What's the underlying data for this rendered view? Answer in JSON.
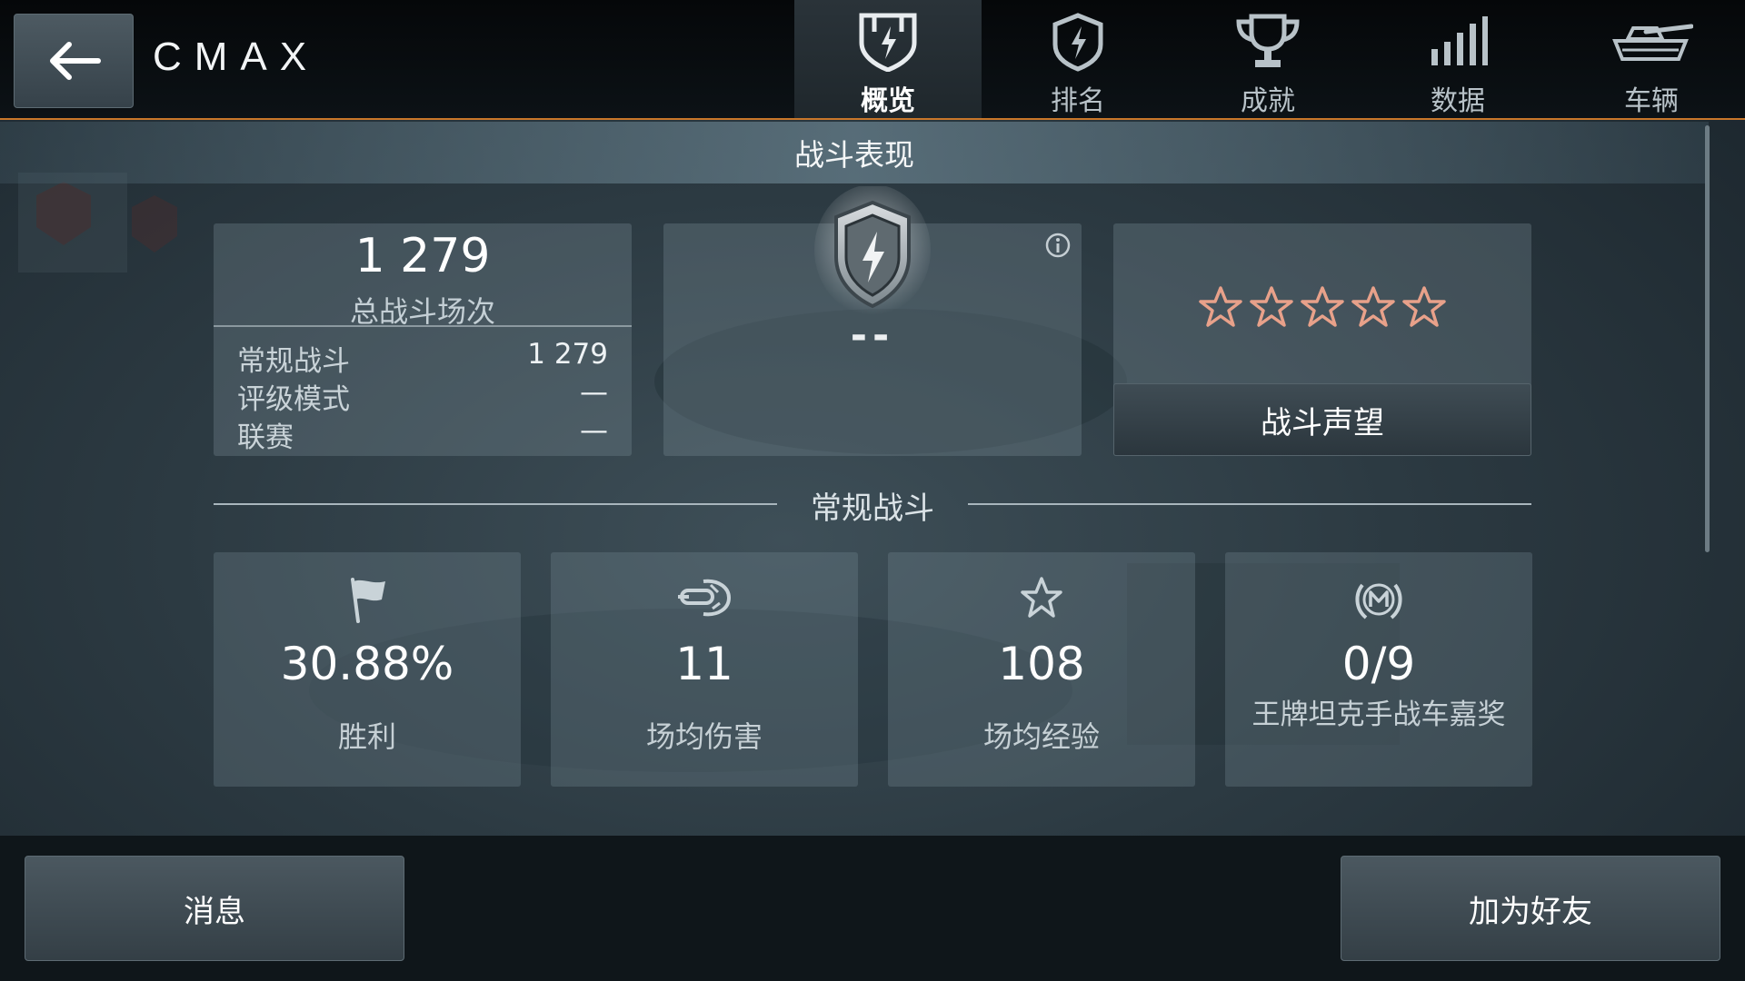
{
  "player": {
    "name": "CMAX"
  },
  "tabs": [
    {
      "label": "概览",
      "icon": "shield-tab-icon",
      "active": true
    },
    {
      "label": "排名",
      "icon": "ranking-icon",
      "active": false
    },
    {
      "label": "成就",
      "icon": "trophy-icon",
      "active": false
    },
    {
      "label": "数据",
      "icon": "bar-signal-icon",
      "active": false
    },
    {
      "label": "车辆",
      "icon": "tank-icon",
      "active": false
    }
  ],
  "section": {
    "title": "战斗表现"
  },
  "battles": {
    "total": "1 279",
    "total_label": "总战斗场次",
    "rows": [
      {
        "label": "常规战斗",
        "value": "1 279"
      },
      {
        "label": "评级模式",
        "value": "—"
      },
      {
        "label": "联赛",
        "value": "—"
      }
    ]
  },
  "rating": {
    "value": "--",
    "icon": "rating-shield-icon"
  },
  "reputation": {
    "stars": 5,
    "filled": 0,
    "button_label": "战斗声望",
    "star_color": "#e8a18a"
  },
  "regular": {
    "title": "常规战斗",
    "stats": [
      {
        "icon": "flag-icon",
        "value": "30.88%",
        "label": "胜利"
      },
      {
        "icon": "shell-damage-icon",
        "value": "11",
        "label": "场均伤害"
      },
      {
        "icon": "star-icon",
        "value": "108",
        "label": "场均经验"
      },
      {
        "icon": "mastery-badge-icon",
        "value": "0/9",
        "label": "王牌坦克手战车嘉奖"
      }
    ]
  },
  "bottom": {
    "message_label": "消息",
    "add_friend_label": "加为好友"
  },
  "colors": {
    "accent_line": "#c9772a"
  }
}
